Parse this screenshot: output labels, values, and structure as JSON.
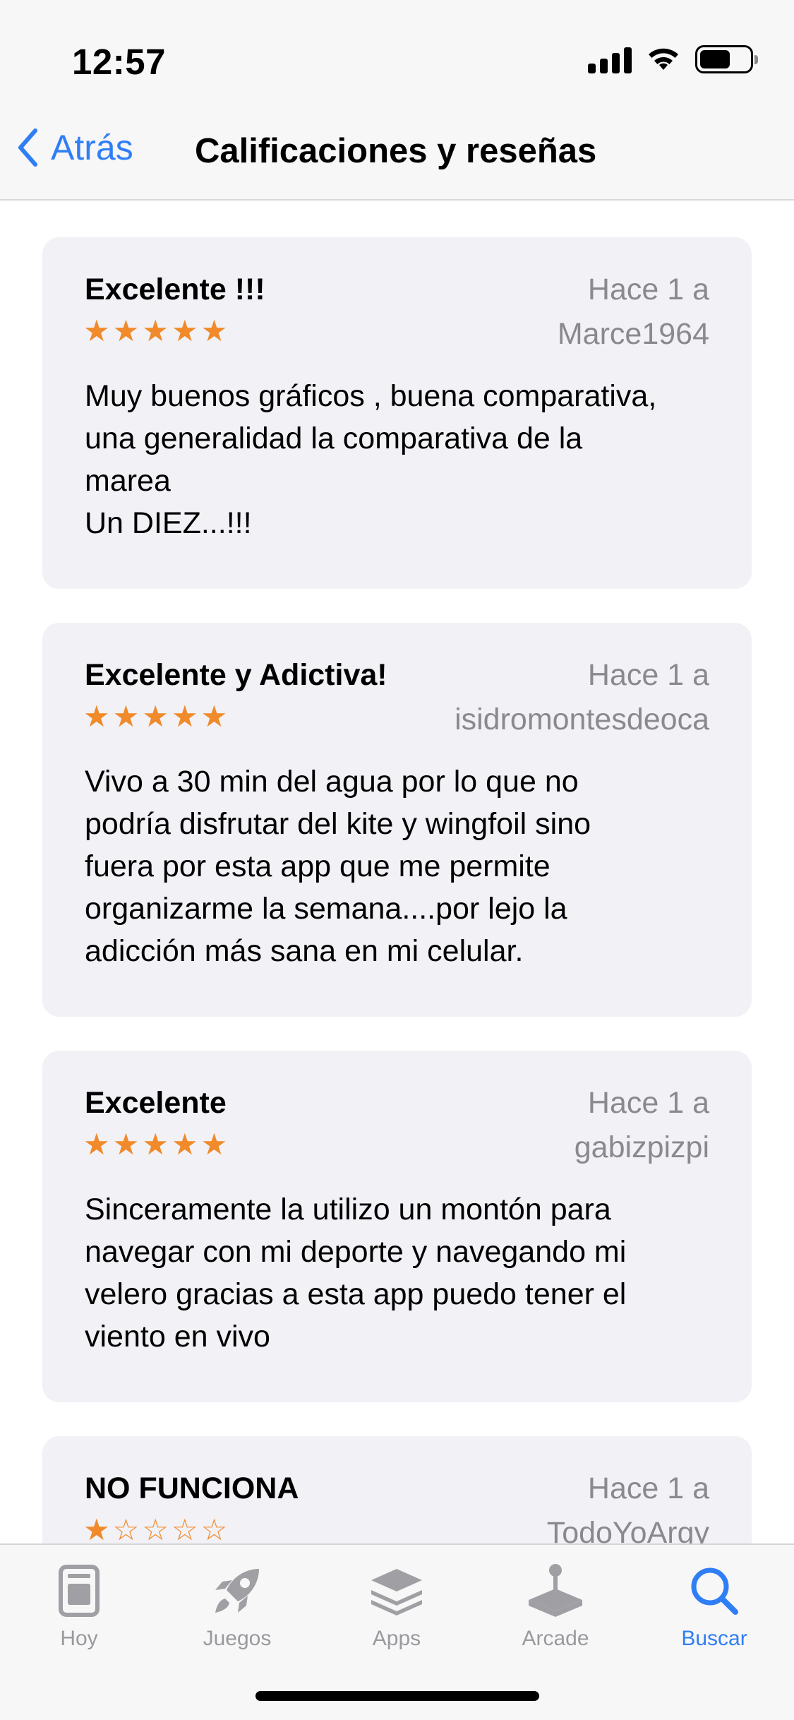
{
  "status_bar": {
    "time": "12:57"
  },
  "nav": {
    "back_label": "Atrás",
    "title": "Calificaciones y reseñas"
  },
  "reviews": [
    {
      "title": "Excelente !!!",
      "date": "Hace 1 a",
      "author": "Marce1964",
      "rating": 5,
      "body": "Muy buenos gráficos , buena comparativa,\nuna generalidad la comparativa de la\nmarea\nUn DIEZ...!!!"
    },
    {
      "title": "Excelente y Adictiva!",
      "date": "Hace 1 a",
      "author": "isidromontesdeoca",
      "rating": 5,
      "body": "Vivo a 30 min del agua por lo que no\npodría disfrutar del kite y wingfoil sino\nfuera por esta app que me permite\norganizarme la semana....por lejo la\nadicción más sana en mi celular."
    },
    {
      "title": "Excelente",
      "date": "Hace 1 a",
      "author": "gabizpizpi",
      "rating": 5,
      "body": "Sinceramente la utilizo un montón para\nnavegar con mi deporte y navegando mi\nvelero gracias a esta app puedo tener el\nviento en vivo"
    },
    {
      "title": "NO FUNCIONA",
      "date": "Hace 1 a",
      "author": "TodoYoArgy",
      "rating": 1,
      "body": ""
    }
  ],
  "tabbar": {
    "tabs": [
      {
        "label": "Hoy",
        "icon": "today-icon"
      },
      {
        "label": "Juegos",
        "icon": "rocket-icon"
      },
      {
        "label": "Apps",
        "icon": "apps-stack-icon"
      },
      {
        "label": "Arcade",
        "icon": "arcade-joystick-icon"
      },
      {
        "label": "Buscar",
        "icon": "search-icon"
      }
    ],
    "active": "Buscar"
  },
  "colors": {
    "accent": "#2f7ef5",
    "star": "#f08a2a",
    "card_bg": "#f1f1f6"
  }
}
